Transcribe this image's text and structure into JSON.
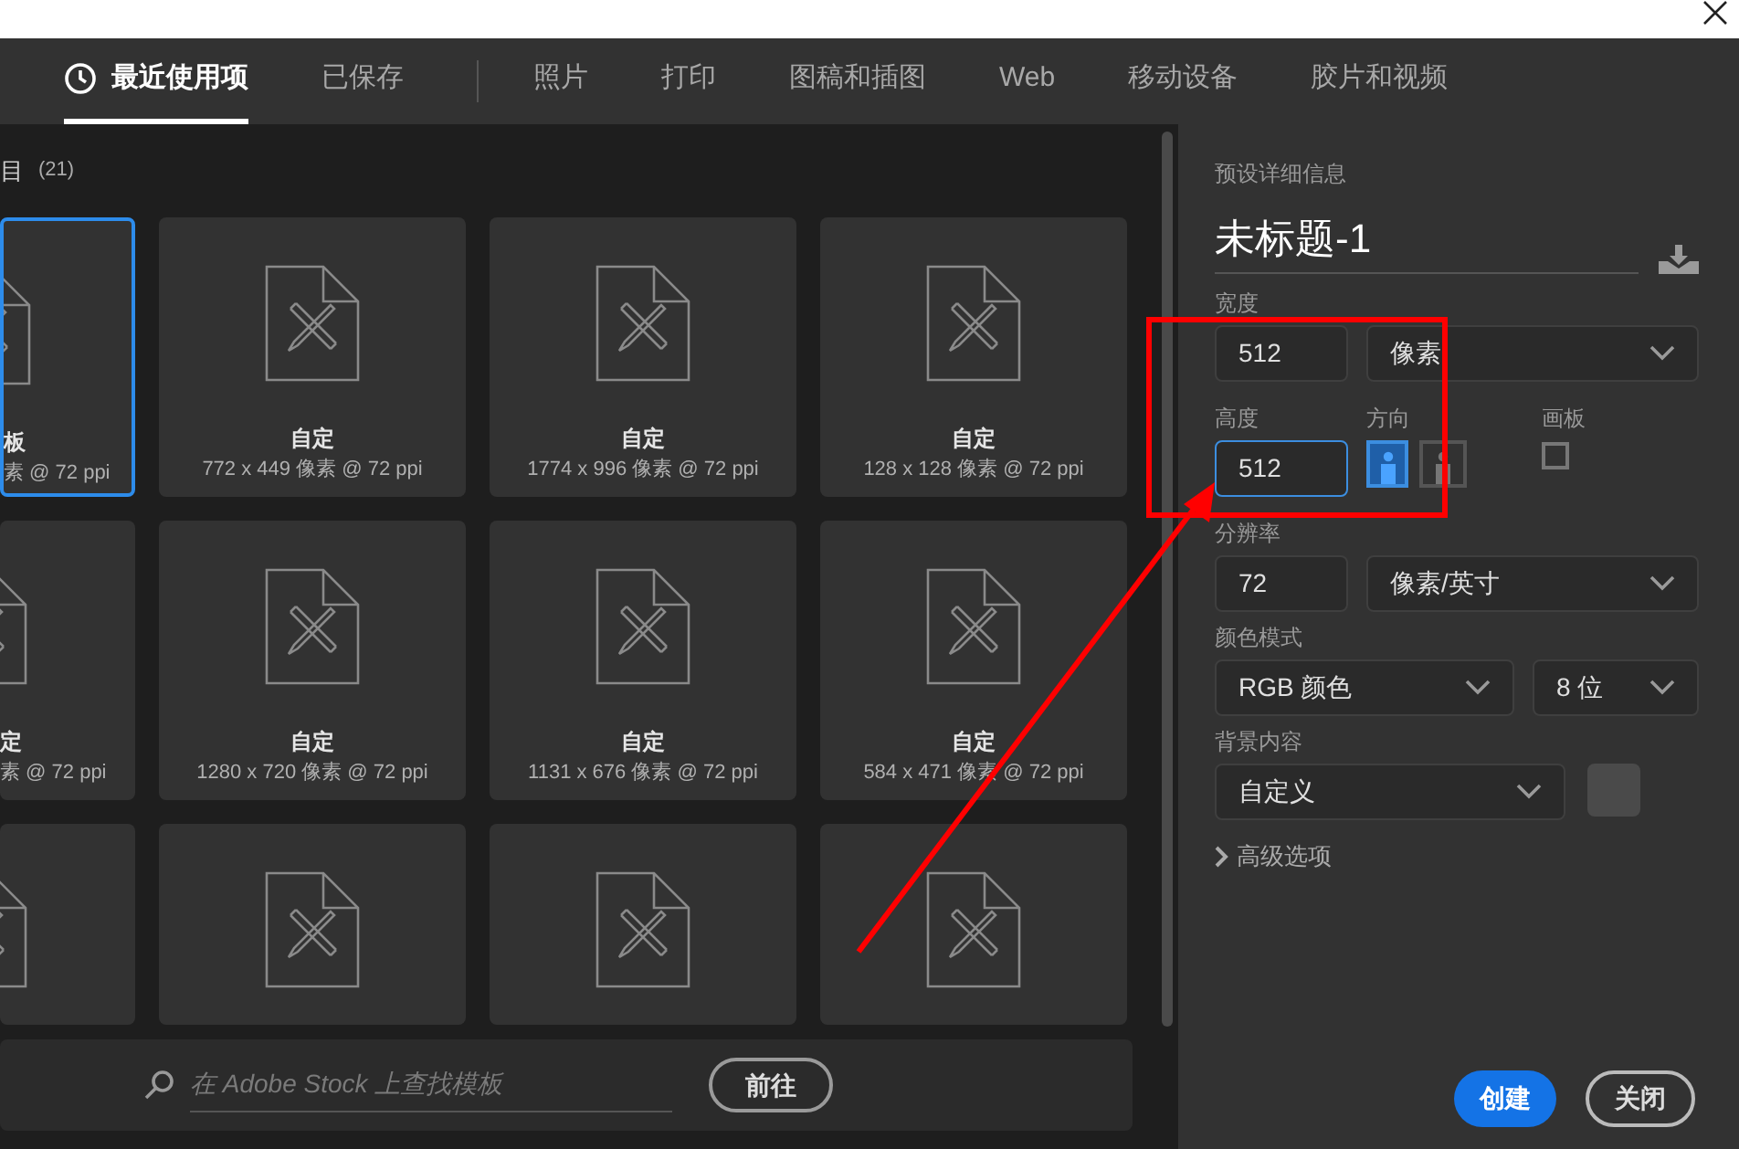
{
  "tabs": [
    {
      "label": "最近使用项",
      "selected": true
    },
    {
      "label": "已保存",
      "selected": false
    },
    {
      "label": "照片",
      "selected": false
    },
    {
      "label": "打印",
      "selected": false
    },
    {
      "label": "图稿和插图",
      "selected": false
    },
    {
      "label": "Web",
      "selected": false
    },
    {
      "label": "移动设备",
      "selected": false
    },
    {
      "label": "胶片和视频",
      "selected": false
    }
  ],
  "recent": {
    "heading": "目",
    "count": "(21)",
    "cards": [
      {
        "name": "板",
        "size": "素 @ 72 ppi",
        "selected": true
      },
      {
        "name": "自定",
        "size": "772 x 449 像素 @ 72 ppi",
        "selected": false
      },
      {
        "name": "自定",
        "size": "1774 x 996 像素 @ 72 ppi",
        "selected": false
      },
      {
        "name": "自定",
        "size": "128 x 128 像素 @ 72 ppi",
        "selected": false
      },
      {
        "name": "定",
        "size": "素 @ 72 ppi",
        "selected": false
      },
      {
        "name": "自定",
        "size": "1280 x 720 像素 @ 72 ppi",
        "selected": false
      },
      {
        "name": "自定",
        "size": "1131 x 676 像素 @ 72 ppi",
        "selected": false
      },
      {
        "name": "自定",
        "size": "584 x 471 像素 @ 72 ppi",
        "selected": false
      },
      {
        "selected": false
      },
      {
        "selected": false
      },
      {
        "selected": false
      },
      {
        "selected": false
      }
    ]
  },
  "stock_search": {
    "placeholder": "在 Adobe Stock 上查找模板",
    "button": "前往"
  },
  "preset_details": {
    "title": "预设详细信息",
    "document_name": "未标题-1",
    "width": {
      "label": "宽度",
      "value": "512",
      "unit": "像素",
      "focused": false
    },
    "height": {
      "label": "高度",
      "value": "512",
      "focused": true
    },
    "orientation": {
      "label": "方向",
      "options": [
        {
          "kind": "portrait",
          "selected": true
        },
        {
          "kind": "landscape",
          "selected": false
        }
      ]
    },
    "artboard": {
      "label": "画板",
      "checked": false
    },
    "resolution": {
      "label": "分辨率",
      "value": "72",
      "unit": "像素/英寸"
    },
    "color_mode": {
      "label": "颜色模式",
      "mode": "RGB 颜色",
      "depth": "8 位"
    },
    "background": {
      "label": "背景内容",
      "value": "自定义",
      "color": "#4a4a4a"
    },
    "advanced": {
      "label": "高级选项",
      "expanded": false
    },
    "buttons": [
      {
        "label": "创建",
        "kind": "primary"
      },
      {
        "label": "关闭",
        "kind": "secondary"
      }
    ]
  }
}
